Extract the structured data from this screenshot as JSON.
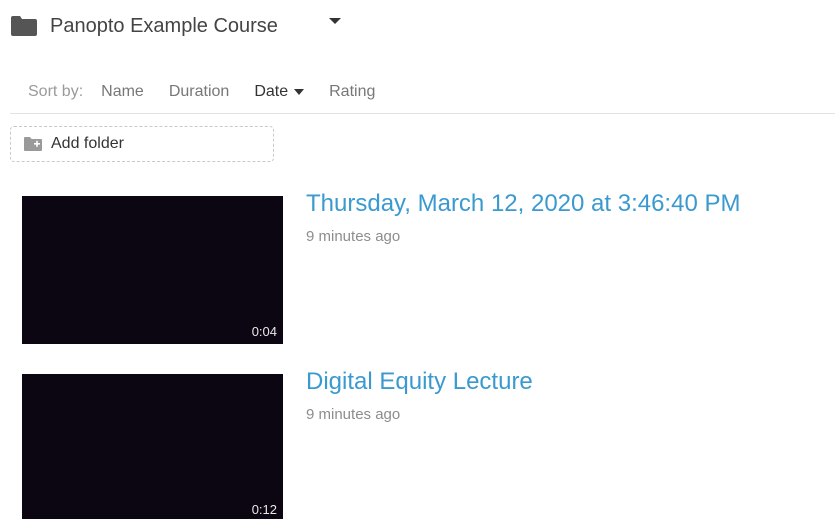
{
  "header": {
    "course_title": "Panopto Example Course",
    "folder_icon": "folder-icon",
    "dropdown_icon": "caret-down-icon"
  },
  "sort": {
    "label": "Sort by:",
    "options": [
      "Name",
      "Duration",
      "Date",
      "Rating"
    ],
    "active": "Date"
  },
  "add_folder": {
    "label": "Add folder",
    "icon": "add-folder-icon"
  },
  "sessions": [
    {
      "title": "Thursday, March 12, 2020 at 3:46:40 PM",
      "meta": "9 minutes ago",
      "duration": "0:04"
    },
    {
      "title": "Digital Equity Lecture",
      "meta": "9 minutes ago",
      "duration": "0:12"
    }
  ],
  "colors": {
    "title_link": "#3a9ad0",
    "thumbnail_bg": "#0c0612"
  }
}
